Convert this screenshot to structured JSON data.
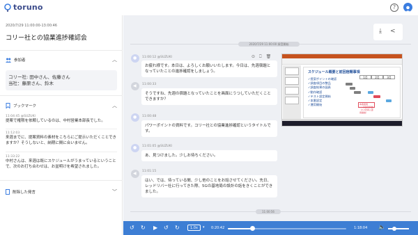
{
  "app": {
    "brand": "toruno"
  },
  "header": {
    "help_icon": "question-circle-icon",
    "avatar_icon": "user-avatar-icon"
  },
  "meeting": {
    "datetime": "2020/7/29 11:00:00-13:00:46",
    "title": "コリー社との協業進捗確認会"
  },
  "participants": {
    "heading": "参加者",
    "lines": [
      "コリー社: 田中さん、佐藤さん",
      "当社：藤原さん、鈴木"
    ]
  },
  "bookmarks": {
    "heading": "ブックマーク",
    "items": [
      {
        "time": "11:04:45 @SUZUKI",
        "text": "提案で権限を依頼しているのは、中村営業本部長でした。"
      },
      {
        "time": "11:12:03",
        "text": "来週までに、提案資料の素材をこちらにご提示いただくことできますか？そうしないと、納期に間に合いません。"
      },
      {
        "time": "11:33:22",
        "text": "中村さんは、来週は既にスケジュールがうまっているということで、次のお打ち合わせは、お盆明けを希望されました。"
      }
    ]
  },
  "deleted": {
    "heading": "削除した発言"
  },
  "transcript": {
    "date_pill": "2020/7/29 11:00:00 録音開始",
    "end_pill": "11:00:56",
    "messages": [
      {
        "time": "11:00:12 @SUZUKI",
        "text": "お疲れ様です。本日は、よろしくお願いいたします。今日は、先週宿題となっていたことの進捗確認をしましょう。",
        "avatar": "user"
      },
      {
        "time": "11:00:33",
        "text": "そうですね、先週の宿題となっていたことを画面にうつしていただくことできますか？",
        "avatar": "audio"
      },
      {
        "time": "11:00:48",
        "text": "パワーポイントの資料です。コリー社との協業進捗確認というタイトルです。",
        "avatar": "user"
      },
      {
        "time": "11:01:05 @SUZUKI",
        "text": "あ、見つけました。少しお待ちください。",
        "avatar": "user"
      },
      {
        "time": "11:01:15",
        "text": "はい、では、待っている間、少し他のことをお話させてください。先日、レッドリバー社に行ってきた際、5Gの基地局の設計の話をきくことができました。",
        "avatar": "audio"
      }
    ]
  },
  "slide": {
    "title": "スケジュール概要と前回宿題事項",
    "months": [
      "1月",
      "2月",
      "3月"
    ],
    "items": [
      "✓提案ポイントの確認",
      "✓調査項目の整品",
      "✓調査結果の図表",
      "✓動作確認",
      "✓テスト設定開始",
      "✓本番設定",
      "✓運用開始"
    ],
    "note1": "本番運用",
    "note2": "1.1次運用開始（2.2次導入運用開始）"
  },
  "player": {
    "speed": "1.0x",
    "current_time": "0:20:42",
    "total_time": "1:18:04",
    "progress": 0.21,
    "volume": 0.3
  }
}
